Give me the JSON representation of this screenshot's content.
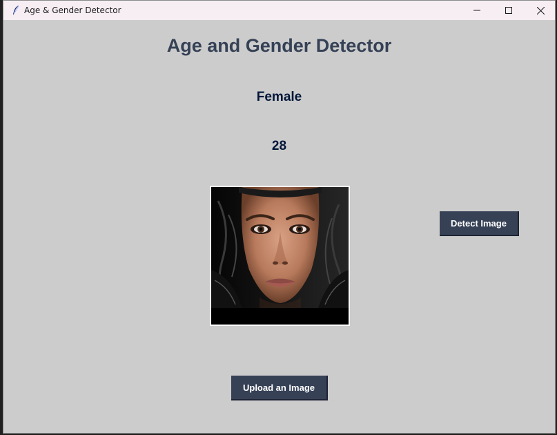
{
  "window": {
    "title": "Age & Gender Detector",
    "icon": "feather-icon"
  },
  "controls": {
    "minimize_icon": "minimize-icon",
    "maximize_icon": "maximize-icon",
    "close_icon": "close-icon"
  },
  "main": {
    "heading": "Age and Gender Detector",
    "gender_result": "Female",
    "age_result": "28",
    "detect_button_label": "Detect Image",
    "upload_button_label": "Upload an Image"
  },
  "colors": {
    "background": "#cccccc",
    "heading": "#364156",
    "result_text": "#011638",
    "button_bg": "#364156",
    "button_text": "#ffffff",
    "titlebar": "#f7eef3"
  }
}
